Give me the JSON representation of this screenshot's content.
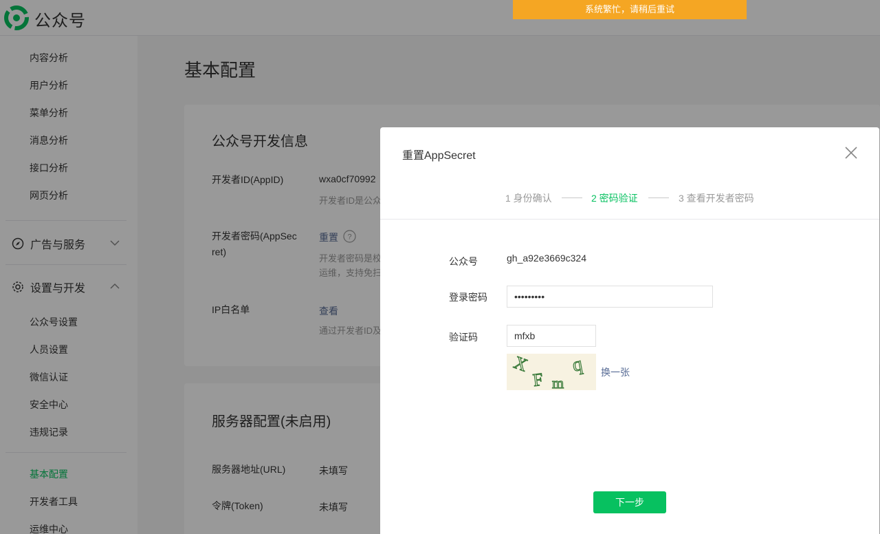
{
  "app": {
    "brand": "公众号"
  },
  "toast": {
    "text": "系统繁忙，请稍后重试",
    "color": "#f5a623"
  },
  "sidebar": {
    "analytics_items": [
      "内容分析",
      "用户分析",
      "菜单分析",
      "消息分析",
      "接口分析",
      "网页分析"
    ],
    "group_ads": {
      "label": "广告与服务",
      "icon": "compass-icon",
      "state": "collapsed"
    },
    "group_settings": {
      "label": "设置与开发",
      "icon": "gear-icon",
      "state": "expanded"
    },
    "settings_items": [
      "公众号设置",
      "人员设置",
      "微信认证",
      "安全中心",
      "违规记录"
    ],
    "dev_items": [
      "基本配置",
      "开发者工具",
      "运维中心"
    ],
    "active_item": "基本配置"
  },
  "main": {
    "page_title": "基本配置",
    "dev_info": {
      "title": "公众号开发信息",
      "appid_label": "开发者ID(AppID)",
      "appid_value": "wxa0cf70992",
      "appid_desc": "开发者ID是公众",
      "secret_label_1": "开发者密码(AppSec",
      "secret_label_2": "ret)",
      "secret_action": "重置",
      "secret_desc_1": "开发者密码是校",
      "secret_desc_2": "运维，支持免扫",
      "ip_label": "IP白名单",
      "ip_action": "查看",
      "ip_desc": "通过开发者ID及"
    },
    "server": {
      "title": "服务器配置(未启用)",
      "url_label": "服务器地址(URL)",
      "url_value": "未填写",
      "token_label": "令牌(Token)",
      "token_value": "未填写"
    }
  },
  "dialog": {
    "title": "重置AppSecret",
    "steps": [
      {
        "label": "1 身份确认",
        "state": "done"
      },
      {
        "label": "2 密码验证",
        "state": "current"
      },
      {
        "label": "3 查看开发者密码",
        "state": "todo"
      }
    ],
    "account_label": "公众号",
    "account_value": "gh_a92e3669c324",
    "password_label": "登录密码",
    "password_value": "•••••••••",
    "captcha_label": "验证码",
    "captcha_value": "mfxb",
    "captcha_image_text": [
      "X",
      "F",
      "m",
      "q"
    ],
    "refresh_label": "换一张",
    "next_label": "下一步",
    "accent_color": "#07c160"
  }
}
